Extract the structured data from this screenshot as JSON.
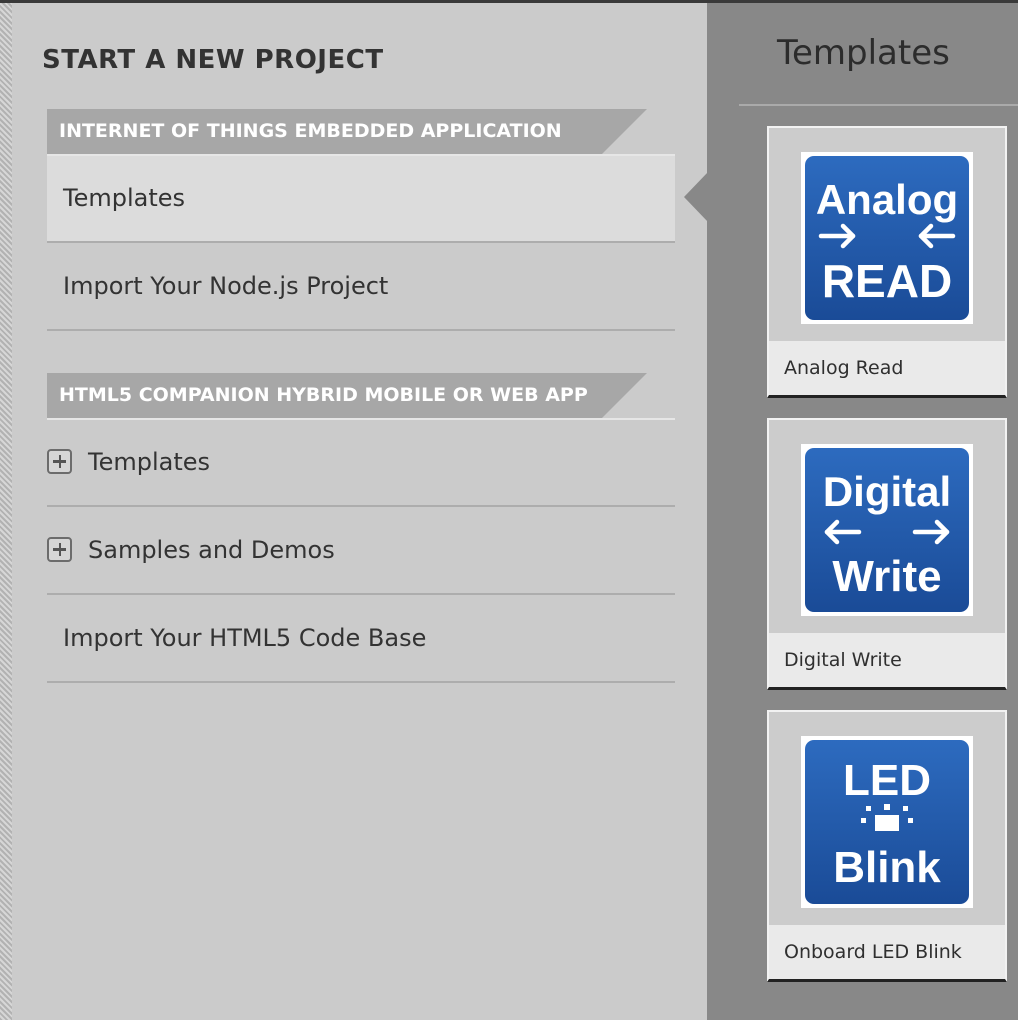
{
  "left_panel": {
    "title": "START A NEW PROJECT",
    "sections": [
      {
        "header": "INTERNET OF THINGS EMBEDDED APPLICATION",
        "items": [
          {
            "label": "Templates",
            "selected": true
          },
          {
            "label": "Import Your Node.js Project",
            "selected": false
          }
        ]
      },
      {
        "header": "HTML5 COMPANION HYBRID MOBILE OR WEB APP",
        "items": [
          {
            "label": "Templates",
            "expandable": true,
            "icon": "plus-box-icon"
          },
          {
            "label": "Samples and Demos",
            "expandable": true,
            "icon": "plus-box-icon"
          },
          {
            "label": "Import Your HTML5 Code Base",
            "expandable": false
          }
        ]
      }
    ]
  },
  "right_panel": {
    "title": "Templates",
    "cards": [
      {
        "label": "Analog Read",
        "icon_top": "Analog",
        "icon_bottom": "READ",
        "icon": "analog-read-icon"
      },
      {
        "label": "Digital Write",
        "icon_top": "Digital",
        "icon_bottom": "Write",
        "icon": "digital-write-icon"
      },
      {
        "label": "Onboard LED Blink",
        "icon_top": "LED",
        "icon_bottom": "Blink",
        "icon": "led-blink-icon"
      }
    ]
  },
  "colors": {
    "left_bg": "#cbcbcb",
    "right_bg": "#888888",
    "header_bg": "#a7a7a7",
    "selected_bg": "#dcdcdc",
    "icon_blue": "#1f56a6"
  }
}
